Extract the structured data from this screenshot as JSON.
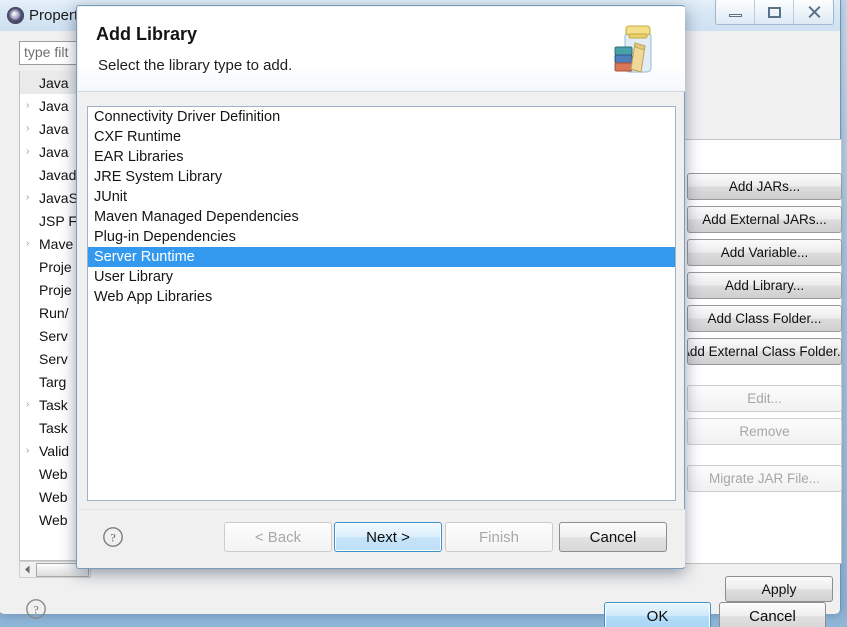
{
  "background_window": {
    "title": "Properties",
    "icon": "properties-gear-icon",
    "window_controls": {
      "minimize": "minimize-icon",
      "restore": "restore-icon",
      "close": "close-icon"
    },
    "navigation": {
      "back": "back-arrow-icon",
      "back_menu": "chevron-down-icon",
      "forward": "forward-arrow-icon",
      "forward_menu": "chevron-down-icon",
      "more_menu": "chevron-down-icon"
    },
    "filter": {
      "placeholder": "type filter text",
      "value": "type filt"
    },
    "tree_items": [
      {
        "label": "Java",
        "expandable": false,
        "selected": true
      },
      {
        "label": "Java",
        "expandable": true,
        "selected": false
      },
      {
        "label": "Java",
        "expandable": true,
        "selected": false
      },
      {
        "label": "Java",
        "expandable": true,
        "selected": false
      },
      {
        "label": "Javad",
        "expandable": false,
        "selected": false
      },
      {
        "label": "JavaS",
        "expandable": true,
        "selected": false
      },
      {
        "label": "JSP F",
        "expandable": false,
        "selected": false
      },
      {
        "label": "Mave",
        "expandable": true,
        "selected": false
      },
      {
        "label": "Proje",
        "expandable": false,
        "selected": false
      },
      {
        "label": "Proje",
        "expandable": false,
        "selected": false
      },
      {
        "label": "Run/",
        "expandable": false,
        "selected": false
      },
      {
        "label": "Serv",
        "expandable": false,
        "selected": false
      },
      {
        "label": "Serv",
        "expandable": false,
        "selected": false
      },
      {
        "label": "Targ",
        "expandable": false,
        "selected": false
      },
      {
        "label": "Task",
        "expandable": true,
        "selected": false
      },
      {
        "label": "Task",
        "expandable": false,
        "selected": false
      },
      {
        "label": "Valid",
        "expandable": true,
        "selected": false
      },
      {
        "label": "Web",
        "expandable": false,
        "selected": false
      },
      {
        "label": "Web",
        "expandable": false,
        "selected": false
      },
      {
        "label": "Web",
        "expandable": false,
        "selected": false
      }
    ],
    "build_path_buttons": [
      {
        "label": "Add JARs...",
        "enabled": true
      },
      {
        "label": "Add External JARs...",
        "enabled": true
      },
      {
        "label": "Add Variable...",
        "enabled": true
      },
      {
        "label": "Add Library...",
        "enabled": true
      },
      {
        "label": "Add Class Folder...",
        "enabled": true
      },
      {
        "label": "Add External Class Folder...",
        "enabled": true
      },
      {
        "label": "Edit...",
        "enabled": false
      },
      {
        "label": "Remove",
        "enabled": false
      },
      {
        "label": "Migrate JAR File...",
        "enabled": false
      }
    ],
    "apply_label": "Apply",
    "ok_label": "OK",
    "cancel_label": "Cancel",
    "help_icon": "help-question-icon"
  },
  "dialog": {
    "title": "Add Library",
    "subtitle": "Select the library type to add.",
    "icon": "library-jar-with-books-icon",
    "help_icon": "help-question-icon",
    "list": [
      {
        "label": "Connectivity Driver Definition",
        "selected": false
      },
      {
        "label": "CXF Runtime",
        "selected": false
      },
      {
        "label": "EAR Libraries",
        "selected": false
      },
      {
        "label": "JRE System Library",
        "selected": false
      },
      {
        "label": "JUnit",
        "selected": false
      },
      {
        "label": "Maven Managed Dependencies",
        "selected": false
      },
      {
        "label": "Plug-in Dependencies",
        "selected": false
      },
      {
        "label": "Server Runtime",
        "selected": true
      },
      {
        "label": "User Library",
        "selected": false
      },
      {
        "label": "Web App Libraries",
        "selected": false
      }
    ],
    "buttons": {
      "back": {
        "label": "< Back",
        "enabled": false,
        "default": false
      },
      "next": {
        "label": "Next >",
        "enabled": true,
        "default": true
      },
      "finish": {
        "label": "Finish",
        "enabled": false,
        "default": false
      },
      "cancel": {
        "label": "Cancel",
        "enabled": true,
        "default": false
      }
    }
  },
  "colors": {
    "selection_blue": "#3399ee",
    "default_button_blue": "#3c91c9",
    "dialog_background": "#f0f0f0"
  }
}
